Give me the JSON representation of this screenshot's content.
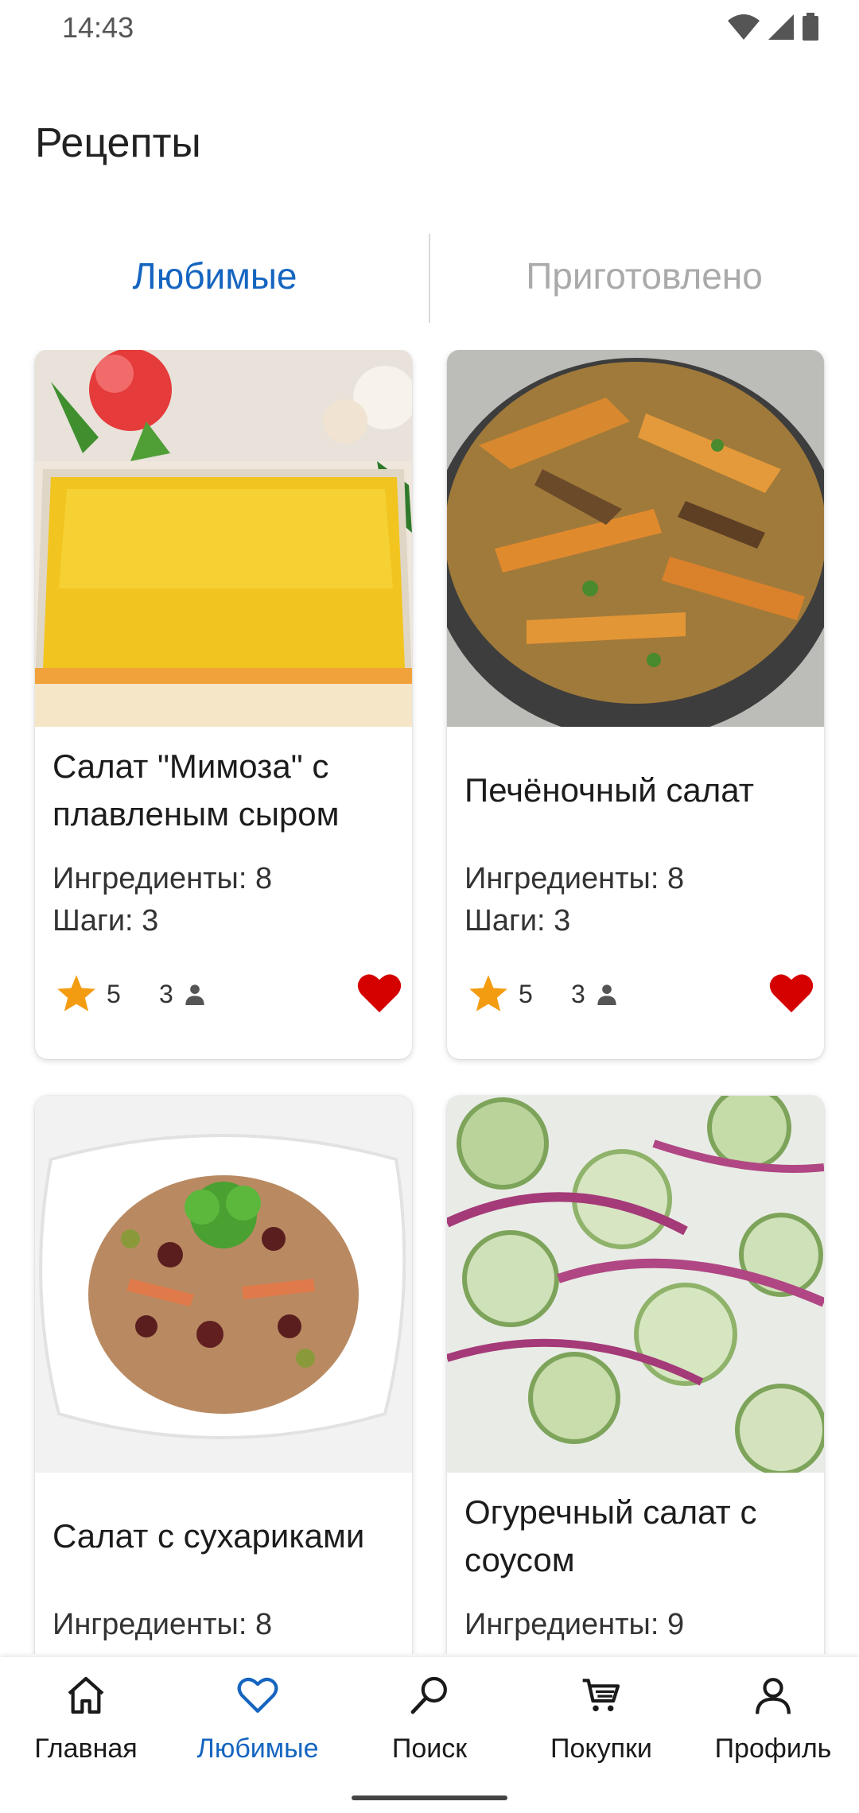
{
  "status_bar": {
    "time": "14:43"
  },
  "page": {
    "title": "Рецепты"
  },
  "tabs": [
    {
      "label": "Любимые",
      "active": true
    },
    {
      "label": "Приготовлено",
      "active": false
    }
  ],
  "recipes": [
    {
      "title": "Салат \"Мимоза\" с плавленым сыром",
      "ingredients": "Ингредиенты: 8",
      "steps": "Шаги: 3",
      "rating": "5",
      "servings": "3",
      "favorite": true,
      "image": "mimosa-salad-photo"
    },
    {
      "title": "Печёночный салат",
      "ingredients": "Ингредиенты: 8",
      "steps": "Шаги: 3",
      "rating": "5",
      "servings": "3",
      "favorite": true,
      "image": "liver-salad-photo"
    },
    {
      "title": "Салат с сухариками",
      "ingredients": "Ингредиенты: 8",
      "steps": "",
      "rating": "",
      "servings": "",
      "favorite": true,
      "image": "crouton-salad-photo"
    },
    {
      "title": "Огуречный салат с соусом",
      "ingredients": "Ингредиенты: 9",
      "steps": "",
      "rating": "",
      "servings": "",
      "favorite": true,
      "image": "cucumber-salad-photo"
    }
  ],
  "bottom_nav": [
    {
      "label": "Главная",
      "icon": "home-icon",
      "active": false
    },
    {
      "label": "Любимые",
      "icon": "heart-outline-icon",
      "active": true
    },
    {
      "label": "Поиск",
      "icon": "search-icon",
      "active": false
    },
    {
      "label": "Покупки",
      "icon": "cart-icon",
      "active": false
    },
    {
      "label": "Профиль",
      "icon": "profile-icon",
      "active": false
    }
  ],
  "colors": {
    "accent": "#1565c0",
    "heart": "#d50000",
    "star": "#f39c12"
  }
}
